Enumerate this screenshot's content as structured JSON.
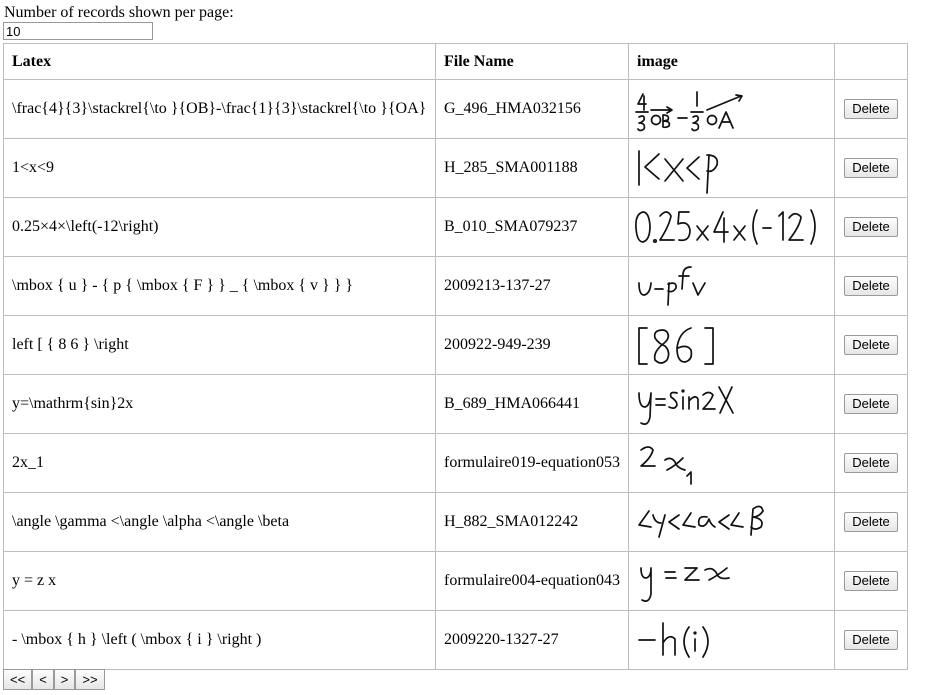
{
  "controls": {
    "per_page_label": "Number of records shown per page:",
    "per_page_value": "10"
  },
  "table": {
    "headers": {
      "latex": "Latex",
      "file_name": "File Name",
      "image": "image",
      "action": ""
    },
    "rows": [
      {
        "latex": "\\frac{4}{3}\\stackrel{\\to }{OB}-\\frac{1}{3}\\stackrel{\\to }{OA}",
        "file_name": "G_496_HMA032156",
        "delete_label": "Delete"
      },
      {
        "latex": "1<x<9",
        "file_name": "H_285_SMA001188",
        "delete_label": "Delete"
      },
      {
        "latex": "0.25×4×\\left(-12\\right)",
        "file_name": "B_010_SMA079237",
        "delete_label": "Delete"
      },
      {
        "latex": "\\mbox { u } - { p { \\mbox { F } } _ { \\mbox { v } } }",
        "file_name": "2009213-137-27",
        "delete_label": "Delete"
      },
      {
        "latex": "left [ { 8 6 } \\right",
        "file_name": "200922-949-239",
        "delete_label": "Delete"
      },
      {
        "latex": "y=\\mathrm{sin}2x",
        "file_name": "B_689_HMA066441",
        "delete_label": "Delete"
      },
      {
        "latex": "2x_1",
        "file_name": "formulaire019-equation053",
        "delete_label": "Delete"
      },
      {
        "latex": "\\angle \\gamma <\\angle \\alpha <\\angle \\beta",
        "file_name": "H_882_SMA012242",
        "delete_label": "Delete"
      },
      {
        "latex": "y = z x",
        "file_name": "formulaire004-equation043",
        "delete_label": "Delete"
      },
      {
        "latex": "- \\mbox { h } \\left ( \\mbox { i } \\right )",
        "file_name": "2009220-1327-27",
        "delete_label": "Delete"
      }
    ]
  },
  "pager": {
    "first": "<<",
    "prev": "<",
    "next": ">",
    "last": ">>"
  }
}
